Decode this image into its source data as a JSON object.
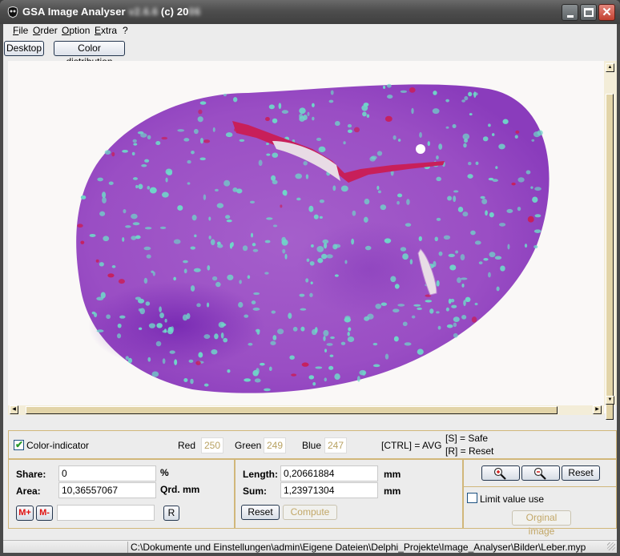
{
  "window": {
    "title_visible": "GSA Image Analyser",
    "title_version_blurred": "v2.6.6",
    "title_copyright": "(c) 20",
    "title_year_blurred": "06",
    "minimize_glyph": "_",
    "maximize_glyph": "□",
    "close_glyph": "✕"
  },
  "menu": [
    {
      "label": "File",
      "accel": "F",
      "rest": "ile"
    },
    {
      "label": "Order",
      "accel": "O",
      "rest": "rder"
    },
    {
      "label": "Option",
      "accel": "O",
      "rest": "ption"
    },
    {
      "label": "Extra",
      "accel": "E",
      "rest": "xtra"
    },
    {
      "label": "?",
      "accel": "",
      "rest": "?"
    }
  ],
  "toolbar": {
    "desktop_label": "Desktop",
    "color_distribution_label": "Color distribution"
  },
  "image": {
    "description": "Stained liver tissue section (purple with cyan and red regions)",
    "colors": {
      "tissue": "#9b4fc4",
      "tissue_dark": "#7a2bb0",
      "cyan": "#6fd6c9",
      "vessel": "#c81f5a",
      "background": "#faf8f7"
    }
  },
  "color_panel": {
    "checkbox_label": "Color-indicator",
    "checked": true,
    "red_label": "Red",
    "red_value": "250",
    "green_label": "Green",
    "green_value": "249",
    "blue_label": "Blue",
    "blue_value": "247",
    "ctrl_hint": "[CTRL] = AVG",
    "save_hint": "[S] = Safe",
    "reset_hint": "[R] = Reset"
  },
  "area_panel": {
    "share_label": "Share:",
    "share_value": "0",
    "share_unit": "%",
    "area_label": "Area:",
    "area_value": "10,36557067",
    "area_unit": "Qrd. mm",
    "m_plus": "M+",
    "m_minus": "M-",
    "memory_value": "",
    "r_button": "R"
  },
  "length_panel": {
    "length_label": "Length:",
    "length_value": "0,20661884",
    "length_unit": "mm",
    "sum_label": "Sum:",
    "sum_value": "1,23971304",
    "sum_unit": "mm",
    "reset_label": "Reset",
    "compute_label": "Compute"
  },
  "zoom_panel": {
    "reset_label": "Reset",
    "limit_label": "Limit value use",
    "limit_checked": false,
    "original_label": "Orginal image"
  },
  "status": {
    "path": "C:\\Dokumente und Einstellungen\\admin\\Eigene Dateien\\Delphi_Projekte\\Image_Analyser\\Bilder\\Leber.myp"
  }
}
